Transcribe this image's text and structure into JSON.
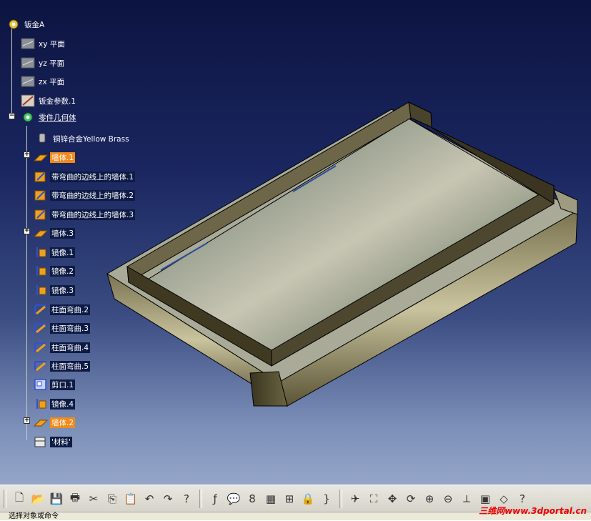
{
  "tree": {
    "root": "钣金A",
    "nodes": [
      {
        "label": "xy 平面",
        "icon": "plane-icon"
      },
      {
        "label": "yz 平面",
        "icon": "plane-icon"
      },
      {
        "label": "zx 平面",
        "icon": "plane-icon"
      },
      {
        "label": "钣金参数.1",
        "icon": "sheetmetal-params-icon"
      },
      {
        "label": "零件几何体",
        "icon": "part-body-icon"
      },
      {
        "label": "铜锌合金Yellow Brass",
        "icon": "material-icon"
      },
      {
        "label": "墙体.1",
        "icon": "wall-icon"
      },
      {
        "label": "带弯曲的边线上的墙体.1",
        "icon": "wall-on-edge-icon"
      },
      {
        "label": "带弯曲的边线上的墙体.2",
        "icon": "wall-on-edge-icon"
      },
      {
        "label": "带弯曲的边线上的墙体.3",
        "icon": "wall-on-edge-icon"
      },
      {
        "label": "墙体.3",
        "icon": "wall-icon"
      },
      {
        "label": "镜像.1",
        "icon": "mirror-icon"
      },
      {
        "label": "镜像.2",
        "icon": "mirror-icon"
      },
      {
        "label": "镜像.3",
        "icon": "mirror-icon"
      },
      {
        "label": "柱面弯曲.2",
        "icon": "cylindrical-bend-icon"
      },
      {
        "label": "柱面弯曲.3",
        "icon": "cylindrical-bend-icon"
      },
      {
        "label": "柱面弯曲.4",
        "icon": "cylindrical-bend-icon"
      },
      {
        "label": "柱面弯曲.5",
        "icon": "cylindrical-bend-icon"
      },
      {
        "label": "剪口.1",
        "icon": "cutout-icon"
      },
      {
        "label": "镜像.4",
        "icon": "mirror-icon"
      },
      {
        "label": "墙体.2",
        "icon": "wall-icon"
      },
      {
        "label": "'材料'",
        "icon": "material-folder-icon"
      }
    ]
  },
  "toolbar": {
    "icons": [
      "new-icon",
      "open-icon",
      "save-icon",
      "print-icon",
      "cut-icon",
      "copy-icon",
      "paste-icon",
      "undo-icon",
      "redo-icon",
      "whats-this-icon",
      "formula-icon",
      "comment-icon",
      "knowledge-icon",
      "table-icon",
      "tree-icon",
      "lock-icon",
      "expand-icon",
      "fly-icon",
      "fit-all-icon",
      "pan-icon",
      "rotate-icon",
      "zoom-in-icon",
      "zoom-out-icon",
      "normal-view-icon",
      "multi-view-icon",
      "iso-view-icon",
      "help-icon"
    ]
  },
  "status": {
    "text": "选择对象或命令"
  },
  "watermark": "三维网www.3dportal.cn",
  "colors": {
    "selected": "#f08a1c",
    "label_bg": "#0d1b45",
    "background_top": "#0c1440",
    "background_bottom": "#95a6c8"
  }
}
